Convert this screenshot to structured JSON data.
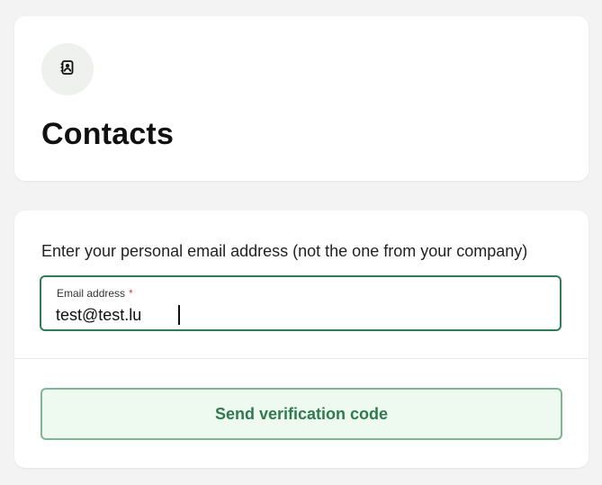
{
  "header": {
    "icon": "contact-book-icon",
    "title": "Contacts"
  },
  "form": {
    "instruction": "Enter your personal email address (not the one from your company)",
    "email": {
      "label": "Email address",
      "required_mark": "*",
      "value": "test@test.lu"
    },
    "send_button_label": "Send verification code"
  },
  "colors": {
    "accent": "#2f7d58",
    "button_background": "#eefaf0",
    "button_border": "#7fb692",
    "required": "#d43f3a"
  }
}
